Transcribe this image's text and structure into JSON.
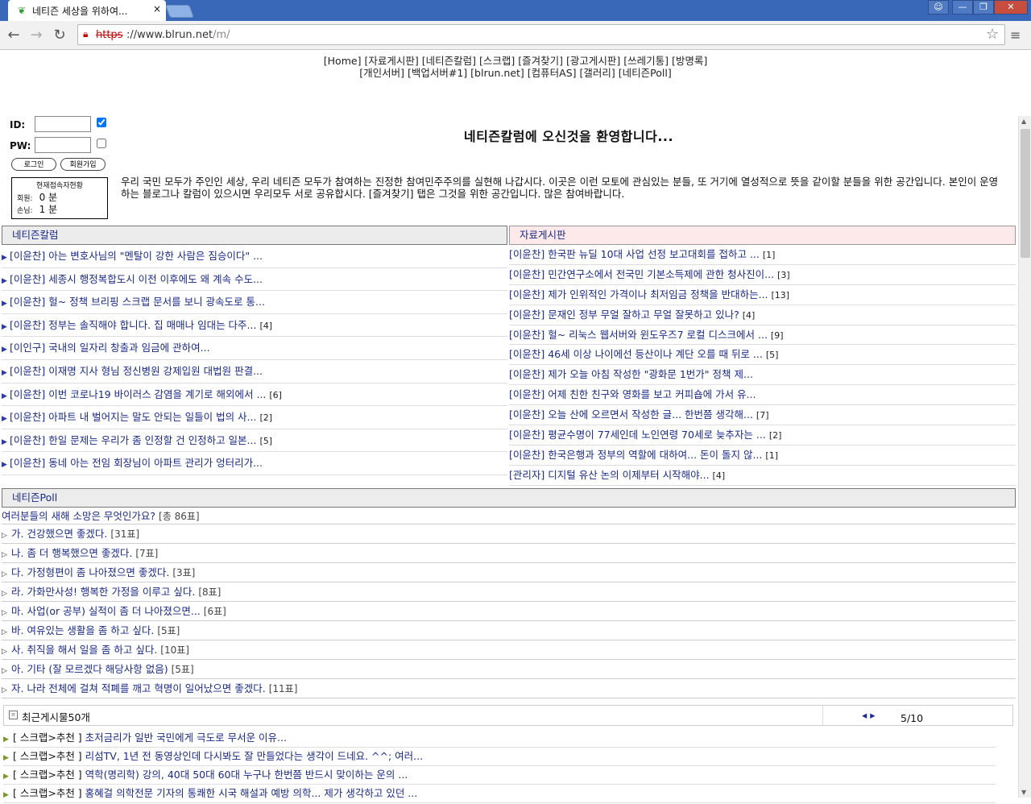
{
  "browser": {
    "tab_title": "네티즌 세상을 위하여...",
    "tab_close": "×",
    "url_scheme": "https",
    "url_host": "://www.blrun.net",
    "url_path": "/m/"
  },
  "topmenu": {
    "row1": [
      "[Home]",
      "[자료게시판]",
      "[네티즌칼럼]",
      "[스크랩]",
      "[즐겨찾기]",
      "[광고게시판]",
      "[쓰레기통]",
      "[방명록]"
    ],
    "row2": [
      "[개인서버]",
      "[백업서버#1]",
      "[blrun.net]",
      "[컴퓨터AS]",
      "[갤러리]",
      "[네티즌Poll]"
    ]
  },
  "login": {
    "id_label": "ID:",
    "pw_label": "PW:",
    "login_btn": "로그인",
    "join_btn": "회원가입",
    "stat_title": "현재접속자현황",
    "member_label": "회원:",
    "member_count": "0 분",
    "guest_label": "손님:",
    "guest_count": "1 분"
  },
  "welcome": "네티즌칼럼에 오신것을 환영합니다...",
  "intro": "우리 국민 모두가 주인인 세상, 우리 네티즌 모두가 참여하는 진정한 참여민주주의를 실현해 나갑시다. 이곳은 이런 모토에 관심있는 분들, 또 거기에 열성적으로 뜻을 같이할 분들을 위한 공간입니다. 본인이 운영하는 블로그나 칼럼이 있으시면 우리모두 서로 공유합시다. [즐겨찾기] 탭은 그것을 위한 공간입니다. 많은 참여바랍니다.",
  "column_board": {
    "title": "네티즌칼럼",
    "items": [
      {
        "text": "[이윤찬] 아는 변호사님의 \"멘탈이 강한 사람은 짐승이다\" ...",
        "count": ""
      },
      {
        "text": "[이윤찬] 세종시 행정복합도시 이전 이후에도 왜 계속 수도...",
        "count": ""
      },
      {
        "text": "[이윤찬] 헐~ 정책 브리핑 스크랩 문서를 보니 광속도로 통...",
        "count": ""
      },
      {
        "text": "[이윤찬] 정부는 솔직해야 합니다. 집 매매나 임대는 다주...",
        "count": "[4]"
      },
      {
        "text": "[이인구] 국내의 일자리 창출과 임금에 관하여...",
        "count": ""
      },
      {
        "text": "[이윤찬] 이재명 지사 형님 정신병원 강제입원 대법원 판결...",
        "count": ""
      },
      {
        "text": "[이윤찬] 이번 코로나19 바이러스 감염을 계기로 해외에서 ...",
        "count": "[6]"
      },
      {
        "text": "[이윤찬] 아파트 내 벌어지는 말도 안되는 일들이 법의 사...",
        "count": "[2]"
      },
      {
        "text": "[이윤찬] 한일 문제는 우리가 좀 인정할 건 인정하고 일본...",
        "count": "[5]"
      },
      {
        "text": "[이윤찬] 동네 아는 전임 회장님이 아파트 관리가 엉터리가...",
        "count": ""
      }
    ]
  },
  "data_board": {
    "title": "자료게시판",
    "items": [
      {
        "text": "[이윤찬] 한국판 뉴딜 10대 사업 선정 보고대회를 접하고 ...",
        "count": "[1]"
      },
      {
        "text": "[이윤찬] 민간연구소에서 전국민 기본소득제에 관한 청사진이...",
        "count": "[3]"
      },
      {
        "text": "[이윤찬] 제가 인위적인 가격이나 최저임금 정책을 반대하는...",
        "count": "[13]"
      },
      {
        "text": "[이윤찬] 문재인 정부 무얼 잘하고 무얼 잘못하고 있나?",
        "count": "[4]"
      },
      {
        "text": "[이윤찬] 헐~ 리눅스 웹서버와 윈도우즈7 로컬 디스크에서 ...",
        "count": "[9]"
      },
      {
        "text": "[이윤찬] 46세 이상 나이에선 등산이나 계단 오를 때 뒤로 ...",
        "count": "[5]"
      },
      {
        "text": "[이윤찬] 제가 오늘 아침 작성한 \"광화문 1번가\" 정책 제...",
        "count": ""
      },
      {
        "text": "[이윤찬] 어제 친한 친구와 영화를 보고 커피숍에 가서 유...",
        "count": ""
      },
      {
        "text": "[이윤찬] 오늘 산에 오르면서 작성한 글... 한번쯤 생각해...",
        "count": "[7]"
      },
      {
        "text": "[이윤찬] 평균수명이 77세인데 노인연령 70세로 늦추자는 ...",
        "count": "[2]"
      },
      {
        "text": "[이윤찬] 한국은행과 정부의 역할에 대하여... 돈이 돌지 않...",
        "count": "[1]"
      },
      {
        "text": "[관리자] 디지털 유산 논의 이제부터 시작해야...",
        "count": "[4]"
      }
    ]
  },
  "poll": {
    "title": "네티즌Poll",
    "question": "여러분들의 새해 소망은 무엇인가요?",
    "total": "[총 86표]",
    "options": [
      {
        "text": "가. 건강했으면 좋겠다.",
        "votes": "[31표]"
      },
      {
        "text": "나. 좀 더 행복했으면 좋겠다.",
        "votes": "[7표]"
      },
      {
        "text": "다. 가정형편이 좀 나아졌으면 좋겠다.",
        "votes": "[3표]"
      },
      {
        "text": "라. 가화만사성! 행복한 가정을 이루고 싶다.",
        "votes": "[8표]"
      },
      {
        "text": "마. 사업(or 공부) 실적이 좀 더 나아졌으면...",
        "votes": "[6표]"
      },
      {
        "text": "바. 여유있는 생활을 좀 하고 싶다.",
        "votes": "[5표]"
      },
      {
        "text": "사. 취직을 해서 일을 좀 하고 싶다.",
        "votes": "[10표]"
      },
      {
        "text": "아. 기타 (잘 모르겠다 해당사항 없음)",
        "votes": "[5표]"
      },
      {
        "text": "자. 나라 전체에 걸쳐 적폐를 깨고 혁명이 일어났으면 좋겠다.",
        "votes": "[11표]"
      }
    ]
  },
  "recent": {
    "title": "최근게시물50개",
    "pager": "5/10",
    "items": [
      {
        "prefix": "[ 스크랩>추천 ]",
        "text": "초저금리가 일반 국민에게 극도로 무서운 이유..."
      },
      {
        "prefix": "[ 스크랩>추천 ]",
        "text": "리섬TV, 1년 전 동영상인데 다시봐도 잘 만들었다는 생각이 드네요. ^^; 여러..."
      },
      {
        "prefix": "[ 스크랩>추천 ]",
        "text": "역학(명리학) 강의, 40대 50대 60대 누구나 한번쯤 반드시 맞이하는 운의 ..."
      },
      {
        "prefix": "[ 스크랩>추천 ]",
        "text": "홍혜걸 의학전문 기자의 통쾌한 시국 해설과 예방 의학... 제가 생각하고 있던 ..."
      }
    ]
  },
  "colors": {
    "titlebar": "#3a68b8",
    "link": "#1a2a8a",
    "data_board_head": "#fde9e9"
  }
}
